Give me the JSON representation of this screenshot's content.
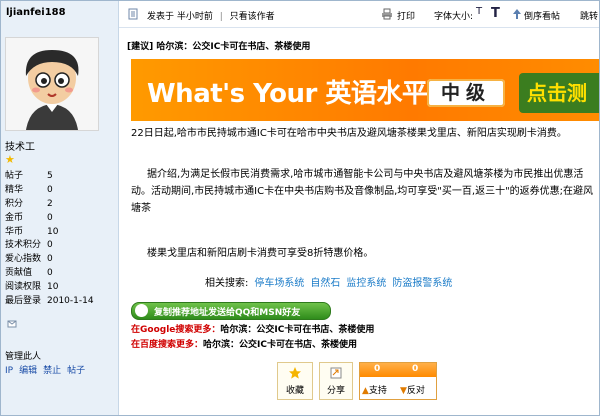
{
  "user": {
    "name": "ljianfei188",
    "rank": "技术工",
    "stats": [
      {
        "label": "帖子",
        "value": "5"
      },
      {
        "label": "精华",
        "value": "0"
      },
      {
        "label": "积分",
        "value": "2"
      },
      {
        "label": "金币",
        "value": "0"
      },
      {
        "label": "华币",
        "value": "10"
      },
      {
        "label": "技术积分",
        "value": "0"
      },
      {
        "label": "爱心指数",
        "value": "0"
      },
      {
        "label": "贡献值",
        "value": "0"
      },
      {
        "label": "阅读权限",
        "value": "10"
      },
      {
        "label": "最后登录",
        "value": "2010-1-14"
      }
    ]
  },
  "admin": {
    "label": "管理此人",
    "links": [
      "IP",
      "编辑",
      "禁止",
      "帖子"
    ]
  },
  "toolbar": {
    "posted": "发表于 半小时前",
    "sep": "|",
    "only_author": "只看该作者",
    "print": "打印",
    "font_size": "字体大小:",
    "font_small": "T",
    "font_large": "T",
    "reverse": "倒序看帖",
    "jump": "跳转"
  },
  "post": {
    "tag": "[建议]",
    "title": "哈尔滨：公交IC卡可在书店、茶楼使用",
    "p1": "22日日起,哈市市民持城市通IC卡可在哈市中央书店及避风塘茶楼果戈里店、新阳店实现刷卡消费。",
    "p2": "据介绍,为满足长假市民消费需求,哈市城市通智能卡公司与中央书店及避风塘茶楼为市民推出优惠活动。活动期间,市民持城市通IC卡在中央书店购书及音像制品,均可享受\"买一百,返三十\"的返券优惠;在避风塘茶",
    "p3": "楼果戈里店和新阳店刷卡消费可享受8折特惠价格。"
  },
  "banner": {
    "text": "What's Your 英语水平",
    "level": "中级",
    "button": "点击测"
  },
  "related": {
    "label": "相关搜索:",
    "links": [
      "停车场系统",
      "自然石",
      "监控系统",
      "防盗报警系统"
    ]
  },
  "share": {
    "button": "复制推荐地址发送给QQ和MSN好友"
  },
  "searches": {
    "google_prefix": "在Google搜索更多：",
    "google_text": "哈尔滨：公交IC卡可在书店、茶楼使用",
    "baidu_prefix": "在百度搜索更多：",
    "baidu_text": "哈尔滨：公交IC卡可在书店、茶楼使用"
  },
  "actions": {
    "favorite": "收藏",
    "share": "分享",
    "support_count": "0",
    "oppose_count": "0",
    "support": "支持",
    "oppose": "反对"
  },
  "colors": {
    "accent": "#ff8a00",
    "link": "#1c7cc8",
    "search_prefix": "#d00000",
    "share_green": "#2f8c1b"
  }
}
